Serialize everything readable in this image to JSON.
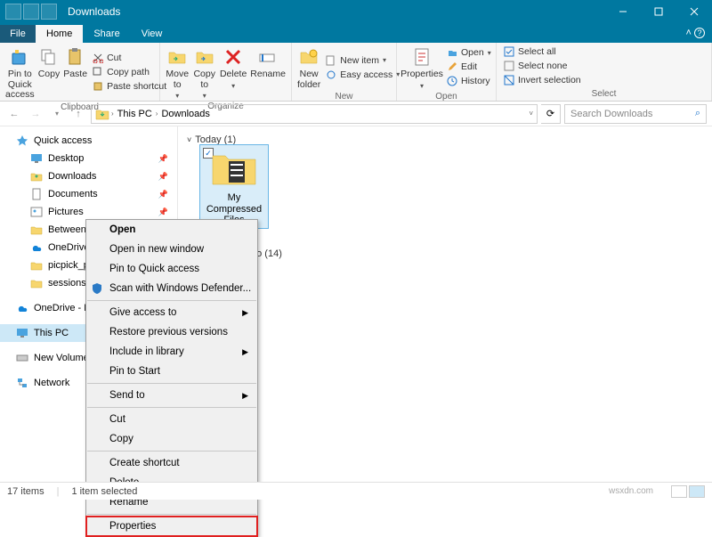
{
  "window": {
    "title": "Downloads"
  },
  "tabs": {
    "file": "File",
    "home": "Home",
    "share": "Share",
    "view": "View"
  },
  "ribbon": {
    "pin": "Pin to Quick\naccess",
    "copy": "Copy",
    "paste": "Paste",
    "cut": "Cut",
    "copypath": "Copy path",
    "pasteshort": "Paste shortcut",
    "clipboard": "Clipboard",
    "moveto": "Move\nto",
    "copyto": "Copy\nto",
    "delete": "Delete",
    "rename": "Rename",
    "organize": "Organize",
    "newfolder": "New\nfolder",
    "newitem": "New item",
    "easyaccess": "Easy access",
    "new": "New",
    "properties": "Properties",
    "open": "Open",
    "edit": "Edit",
    "history": "History",
    "open_g": "Open",
    "selectall": "Select all",
    "selectnone": "Select none",
    "invert": "Invert selection",
    "select": "Select"
  },
  "addr": {
    "seg_pc": "This PC",
    "seg_dl": "Downloads",
    "search_ph": "Search Downloads"
  },
  "nav": {
    "quick": "Quick access",
    "desktop": "Desktop",
    "downloads": "Downloads",
    "documents": "Documents",
    "pictures": "Pictures",
    "between": "Between PCs",
    "onedrive_fa": "OneDrive - Fa…",
    "picpick": "picpick_portal",
    "sessions": "sessions",
    "onedrive_fam": "OneDrive - Fam…",
    "thispc": "This PC",
    "newvol": "New Volume (E…",
    "network": "Network"
  },
  "content": {
    "group_today": "Today (1)",
    "folder_name": "My Compressed Files",
    "group_earlier": "go (14)"
  },
  "ctx": {
    "open": "Open",
    "opennew": "Open in new window",
    "pinquick": "Pin to Quick access",
    "scan": "Scan with Windows Defender...",
    "giveaccess": "Give access to",
    "restore": "Restore previous versions",
    "includelib": "Include in library",
    "pinstart": "Pin to Start",
    "sendto": "Send to",
    "cut": "Cut",
    "copy": "Copy",
    "shortcut": "Create shortcut",
    "delete": "Delete",
    "rename": "Rename",
    "properties": "Properties"
  },
  "status": {
    "items": "17 items",
    "selected": "1 item selected",
    "watermark": "wsxdn.com"
  }
}
